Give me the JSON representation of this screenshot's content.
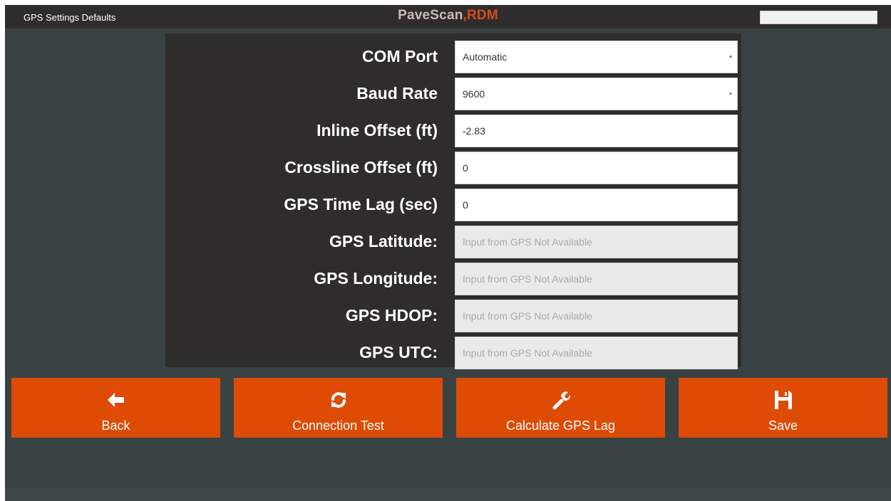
{
  "header": {
    "screen_title": "GPS Settings Defaults",
    "brand_part1": "PaveScan",
    "brand_part2": "RDM",
    "brand_color_primary": "#cdb8b8",
    "brand_color_accent": "#d94a1b"
  },
  "form": {
    "com_port": {
      "label": "COM Port",
      "value": "Automatic"
    },
    "baud_rate": {
      "label": "Baud Rate",
      "value": "9600"
    },
    "inline_offset": {
      "label": "Inline Offset (ft)",
      "value": "-2.83"
    },
    "crossline_offset": {
      "label": "Crossline Offset (ft)",
      "value": "0"
    },
    "time_lag": {
      "label": "GPS Time Lag (sec)",
      "value": "0"
    },
    "latitude": {
      "label": "GPS Latitude:",
      "placeholder": "Input from GPS Not Available"
    },
    "longitude": {
      "label": "GPS Longitude:",
      "placeholder": "Input from GPS Not Available"
    },
    "hdop": {
      "label": "GPS HDOP:",
      "placeholder": "Input from GPS Not Available"
    },
    "utc": {
      "label": "GPS UTC:",
      "placeholder": "Input from GPS Not Available"
    }
  },
  "buttons": {
    "back": {
      "label": "Back",
      "icon": "arrow-left-icon"
    },
    "connection_test": {
      "label": "Connection Test",
      "icon": "refresh-icon"
    },
    "calculate_lag": {
      "label": "Calculate GPS Lag",
      "icon": "wrench-icon"
    },
    "save": {
      "label": "Save",
      "icon": "floppy-disk-icon"
    },
    "color": "#dd4b05"
  }
}
